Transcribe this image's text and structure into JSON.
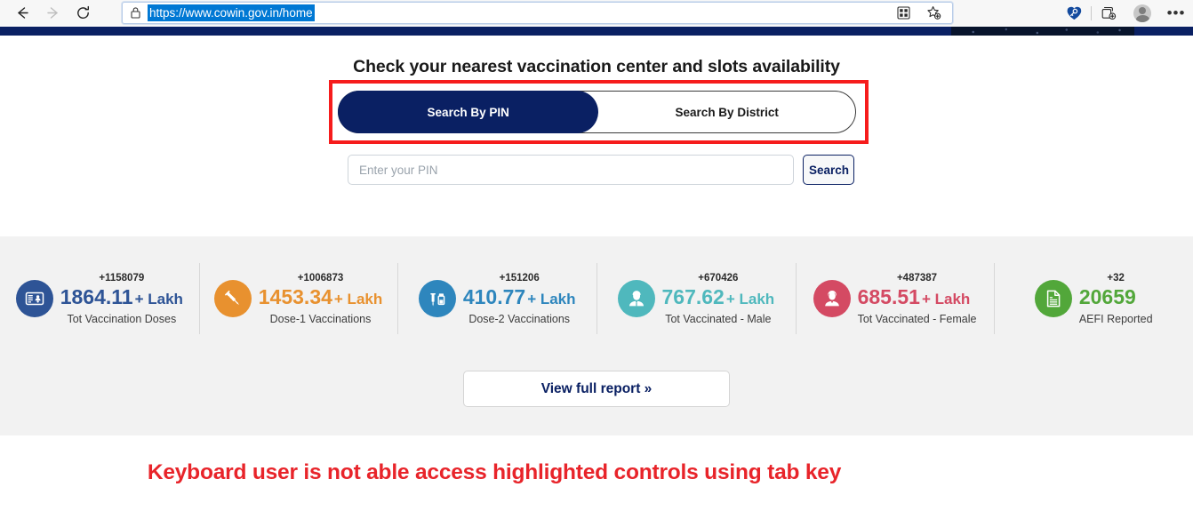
{
  "browser": {
    "back_label": "Back",
    "forward_label": "Forward",
    "reload_label": "Refresh",
    "lock_label": "site-information",
    "url": "https://www.cowin.gov.in/home",
    "omnibox_icons": [
      {
        "name": "split-screen-icon",
        "label": "Split screen"
      },
      {
        "name": "add-favorite-icon",
        "label": "Add this page to favorites"
      }
    ],
    "toolbar_icons": [
      {
        "name": "password-heart-icon",
        "label": "Saved passwords"
      },
      {
        "name": "collections-icon",
        "label": "Collections"
      },
      {
        "name": "profile-avatar",
        "label": "Profile"
      },
      {
        "name": "settings-more-icon",
        "label": "Settings and more"
      }
    ],
    "more_glyph": "•••"
  },
  "search": {
    "headline": "Check your nearest vaccination center and slots availability",
    "toggle": {
      "pin_label": "Search By PIN",
      "district_label": "Search By District",
      "selected": "Search By PIN"
    },
    "pin_placeholder": "Enter your PIN",
    "pin_value": "",
    "search_button": "Search"
  },
  "stats": {
    "cards": [
      {
        "delta": "+1158079",
        "value": "1864.11",
        "unit": "+ Lakh",
        "label": "Tot Vaccination Doses",
        "color": "#2e5496",
        "icon": "vaccination-card-icon"
      },
      {
        "delta": "+1006873",
        "value": "1453.34",
        "unit": "+ Lakh",
        "label": "Dose-1 Vaccinations",
        "color": "#e8912f",
        "icon": "syringe-icon"
      },
      {
        "delta": "+151206",
        "value": "410.77",
        "unit": "+ Lakh",
        "label": "Dose-2 Vaccinations",
        "color": "#2e86bd",
        "icon": "syringe-vial-icon"
      },
      {
        "delta": "+670426",
        "value": "767.62",
        "unit": "+ Lakh",
        "label": "Tot Vaccinated - Male",
        "color": "#4fb8bd",
        "icon": "male-person-icon"
      },
      {
        "delta": "+487387",
        "value": "685.51",
        "unit": "+ Lakh",
        "label": "Tot Vaccinated - Female",
        "color": "#d44a63",
        "icon": "female-person-icon"
      },
      {
        "delta": "+32",
        "value": "20659",
        "unit": "",
        "label": "AEFI Reported",
        "color": "#52a73a",
        "icon": "document-report-icon"
      }
    ],
    "report_button": "View full report »"
  },
  "annotation": {
    "text": "Keyboard user is not able access highlighted controls using tab key",
    "color": "#e8242a"
  },
  "highlight": {
    "border_color": "#f61c1c"
  }
}
